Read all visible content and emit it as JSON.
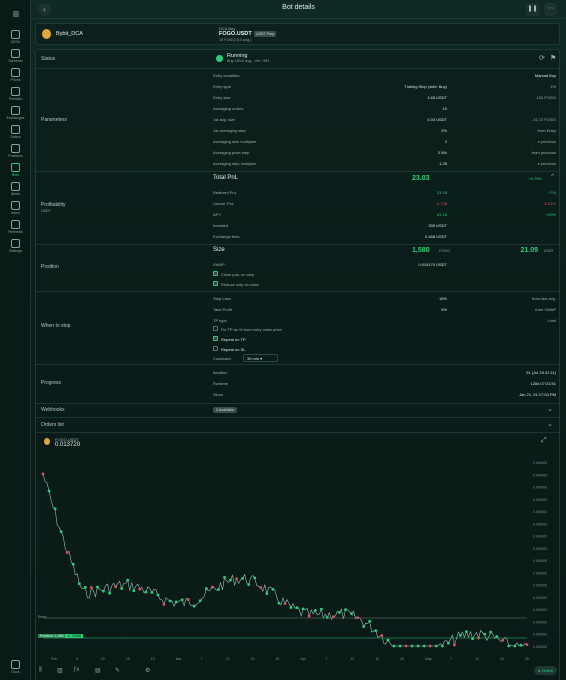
{
  "sidebar": {
    "items": [
      {
        "label": "DEXs"
      },
      {
        "label": "Screener"
      },
      {
        "label": "Prices"
      },
      {
        "label": "Portfolio"
      },
      {
        "label": "Exchanges"
      },
      {
        "label": "Orders"
      },
      {
        "label": "Positions"
      },
      {
        "label": "Bots"
      },
      {
        "label": "Alerts"
      },
      {
        "label": "Inbox"
      },
      {
        "label": "Referrals"
      },
      {
        "label": "Settings"
      }
    ],
    "bottom": "Docs"
  },
  "header": {
    "title": "Bot details"
  },
  "account": {
    "name": "Bybit_DCA"
  },
  "pair": {
    "label": "DCA Buy",
    "name": "FOGO.USDT",
    "badge": "USDT Perp",
    "sub": "10 FOGO (10 avg.)"
  },
  "status": {
    "state": "Running",
    "sub": "Buy 18/10 avg., Ver.: 551"
  },
  "sections": {
    "status": "Status",
    "parameters": "Parameters",
    "profitability": "Profitability",
    "profit_sub": "USDT",
    "position": "Position",
    "when_to_stop": "When to stop",
    "progress": "Progress",
    "webhooks": "Webhooks",
    "orders_list": "Orders list"
  },
  "parameters": [
    {
      "k": "Entry condition",
      "v": "",
      "v2": "Manual Buy"
    },
    {
      "k": "Entry type",
      "v": "Trailing Stop (side: Buy)",
      "v2": "1%"
    },
    {
      "k": "Entry size",
      "v": "1.65 USDT",
      "v2": "126 FOGO"
    },
    {
      "k": "Averaging orders",
      "v": "10",
      "v2": ""
    },
    {
      "k": "1st avg. size",
      "v": "0.33 USDT",
      "v2": "24.72 FOGO"
    },
    {
      "k": "1st averaging step",
      "v": "2%",
      "v2": "from Entry"
    },
    {
      "k": "Averaging size multiplier",
      "v": "2",
      "v2": "x previous"
    },
    {
      "k": "Averaging price step",
      "v": "2.5%",
      "v2": "from previous"
    },
    {
      "k": "Averaging step multiplier",
      "v": "1.25",
      "v2": "x previous"
    }
  ],
  "profit": {
    "total_label": "Total PnL",
    "total": "23.03",
    "total_pct": "+6.79%",
    "rows": [
      {
        "k": "Realized PnL",
        "v": "23.76",
        "v2": "+7%"
      },
      {
        "k": "Unreal. PnL",
        "v": "-0.728",
        "v2": "-0.21%"
      },
      {
        "k": "APY",
        "v": "67.18",
        "v2": "+20%"
      },
      {
        "k": "Invested",
        "v": "339 USDT",
        "v2": ""
      },
      {
        "k": "Exchange fees",
        "v": "0.468 USDT",
        "v2": ""
      }
    ]
  },
  "position": {
    "size_label": "Size",
    "size": "1,580",
    "size_unit": "FOGO",
    "size_usd": "21.09",
    "size_usd_unit": "USDT",
    "vwap_label": "VWAP",
    "vwap": "0.014170 USDT",
    "close_label": "Close pos. on stop",
    "reduce_label": "Reduce only on close"
  },
  "stop": {
    "rows": [
      {
        "k": "Stop Loss",
        "v": "15%",
        "v2": "from last avg."
      },
      {
        "k": "Take Profit",
        "v": "5%",
        "v2": "from VWAP"
      },
      {
        "k": "TP type",
        "v": "",
        "v2": "Limit"
      }
    ],
    "fix_tp": "Fix TP as % from entry order price",
    "repeat_tp": "Repeat on TP",
    "repeat_sl": "Repeat on SL",
    "cooldown_label": "Cooldown",
    "cooldown": "30 min"
  },
  "progress": [
    {
      "k": "Iteration",
      "v": "51 (Jul 23 47:11)"
    },
    {
      "k": "Runtime",
      "v": "128d 07:21:51"
    },
    {
      "k": "Since",
      "v": "Jan 21, 01:17:04 PM"
    }
  ],
  "webhooks": {
    "badge": "2 available"
  },
  "chart": {
    "symbol": "FOGO.USDT",
    "price": "0.013720",
    "position_tag": "Position: 1,580",
    "pnl_tag": "-0.74088",
    "x_labels": [
      "Feb",
      "5",
      "10",
      "15",
      "19",
      "Mar",
      "7",
      "13",
      "19",
      "25",
      "Apr",
      "7",
      "13",
      "19",
      "25",
      "May",
      "7",
      "13",
      "19",
      "25"
    ],
    "y_labels": [
      "0.046000",
      "0.044000",
      "0.042000",
      "0.040000",
      "0.038000",
      "0.036000",
      "0.034000",
      "0.032000",
      "0.030000",
      "0.028000",
      "0.026000",
      "0.024000",
      "0.022000",
      "0.020000",
      "0.018000",
      "0.016000"
    ],
    "entry_label": "Entry",
    "colors": {
      "up": "#28d07a",
      "down": "#e0525a",
      "line": "#9fbfb4"
    }
  },
  "footer": {
    "online": "Online"
  }
}
